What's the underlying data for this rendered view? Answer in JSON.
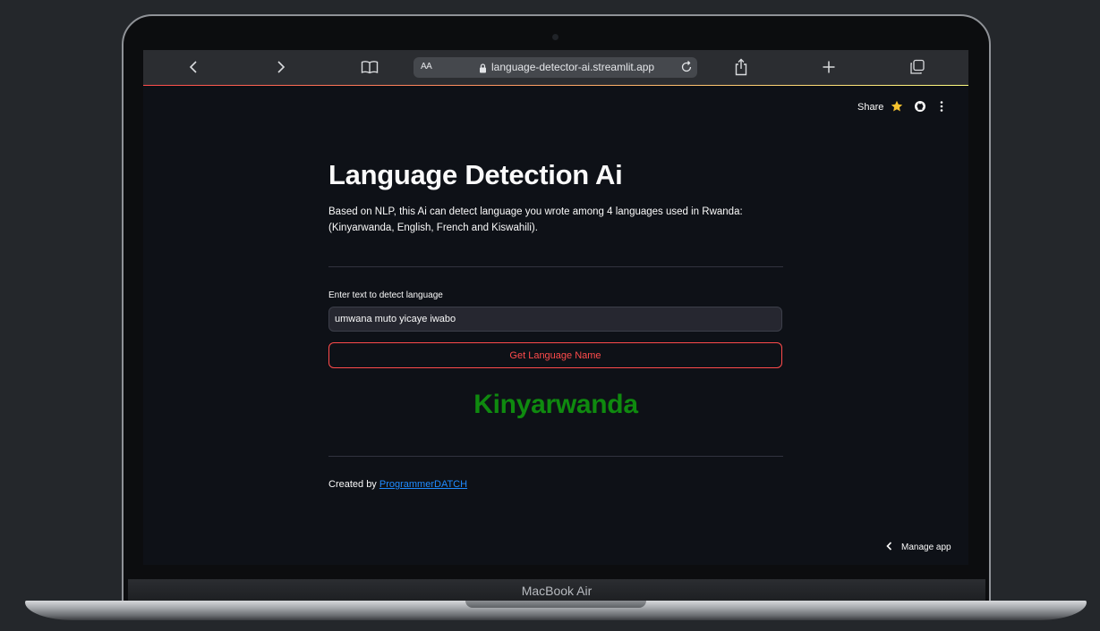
{
  "device": {
    "model_label": "MacBook Air"
  },
  "browser": {
    "text_size_label": "AA",
    "url": "language-detector-ai.streamlit.app"
  },
  "header": {
    "share_label": "Share"
  },
  "main": {
    "title": "Language Detection Ai",
    "description": "Based on NLP, this Ai can detect language you wrote among 4 languages used in Rwanda: (Kinyarwanda, English, French and Kiswahili).",
    "input_label": "Enter text to detect language",
    "input_value": "umwana muto yicaye iwabo",
    "button_label": "Get Language Name",
    "result": "Kinyarwanda"
  },
  "footer": {
    "created_by": "Created by",
    "author_link": "ProgrammerDATCH"
  },
  "manage_app_label": "Manage app",
  "colors": {
    "background": "#0e1117",
    "primary": "#ff4b4b",
    "result_green": "#0f8a0f",
    "link": "#1f8bff",
    "star": "#f7c32e"
  }
}
